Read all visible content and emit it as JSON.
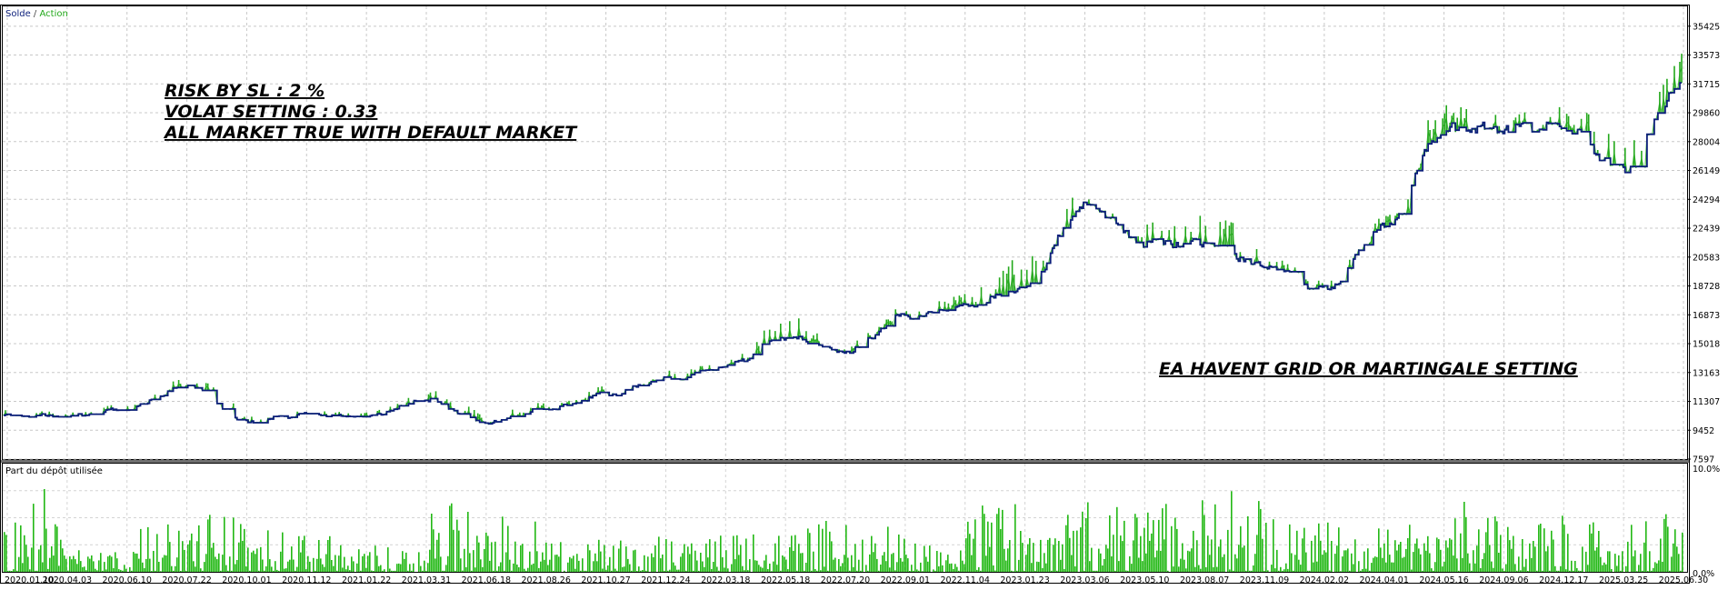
{
  "legend": {
    "balance_label": "Solde",
    "separator": " / ",
    "equity_label": "Action",
    "balance_color": "#0b1e7a",
    "equity_color": "#22a81a"
  },
  "annotations": {
    "line1": "RISK BY SL : 2 %",
    "line2": "VOLAT SETTING : 0.33",
    "line3": "ALL MARKET TRUE WITH DEFAULT MARKET",
    "note": "EA HAVENT GRID OR MARTINGALE SETTING"
  },
  "subpanel": {
    "title": "Part du dépôt utilisée",
    "y_max_label": "10.0%",
    "y_min_label": "0.0%"
  },
  "chart_data": [
    {
      "type": "line",
      "title": "",
      "series_names": [
        "Solde",
        "Action"
      ],
      "ylim": [
        7597,
        36700
      ],
      "y_ticks": [
        "35425",
        "33573",
        "31715",
        "29860",
        "28004",
        "26149",
        "24294",
        "22439",
        "20583",
        "18728",
        "16873",
        "15018",
        "13163",
        "11307",
        "9452",
        "7597"
      ],
      "x_ticks": [
        "2020.01.10",
        "2020.04.03",
        "2020.06.10",
        "2020.07.22",
        "2020.10.01",
        "2020.11.12",
        "2021.01.22",
        "2021.03.31",
        "2021.06.18",
        "2021.08.26",
        "2021.10.27",
        "2021.12.24",
        "2022.03.18",
        "2022.05.18",
        "2022.07.20",
        "2022.09.01",
        "2022.11.04",
        "2023.01.23",
        "2023.03.06",
        "2023.05.10",
        "2023.08.07",
        "2023.11.09",
        "2024.02.02",
        "2024.04.01",
        "2024.05.16",
        "2024.09.06",
        "2024.12.17",
        "2025.03.25",
        "2025.06.30"
      ],
      "x": [
        "2020.01.10",
        "2020.04.03",
        "2020.06.10",
        "2020.07.22",
        "2020.10.01",
        "2020.11.12",
        "2021.01.22",
        "2021.03.31",
        "2021.06.18",
        "2021.08.26",
        "2021.10.27",
        "2021.12.24",
        "2022.03.18",
        "2022.05.18",
        "2022.07.20",
        "2022.09.01",
        "2022.11.04",
        "2023.01.23",
        "2023.03.06",
        "2023.05.10",
        "2023.08.07",
        "2023.11.09",
        "2024.02.02",
        "2024.04.01",
        "2024.05.16",
        "2024.09.06",
        "2024.12.17",
        "2025.03.25",
        "2025.06.30"
      ],
      "series": [
        {
          "name": "Solde",
          "values": [
            10400,
            10350,
            10800,
            12300,
            10000,
            10450,
            10350,
            11400,
            9950,
            10800,
            11750,
            12700,
            13600,
            15400,
            14500,
            16800,
            17400,
            18600,
            24000,
            21500,
            21500,
            20000,
            18500,
            22500,
            28800,
            28900,
            28900,
            26200,
            31900
          ]
        },
        {
          "name": "Action",
          "values": [
            10600,
            10500,
            11000,
            12700,
            10200,
            10650,
            10550,
            11700,
            10300,
            11050,
            12000,
            13000,
            13800,
            16200,
            14800,
            17100,
            18000,
            20000,
            24700,
            22300,
            22900,
            20500,
            18900,
            23000,
            29900,
            29400,
            29700,
            27300,
            33300
          ]
        }
      ],
      "grid": true,
      "legend_position": "top-left"
    },
    {
      "type": "bar",
      "title": "Part du dépôt utilisée",
      "ylim": [
        0,
        10
      ],
      "y_ticks": [
        "10.0%",
        "0.0%"
      ],
      "description_values": "per-trade deposit usage, mostly 1-5%, peaks near 8%",
      "x": [
        "2020.01.10",
        "2020.04.03",
        "2020.06.10",
        "2020.07.22",
        "2020.10.01",
        "2020.11.12",
        "2021.01.22",
        "2021.03.31",
        "2021.06.18",
        "2021.08.26",
        "2021.10.27",
        "2021.12.24",
        "2022.03.18",
        "2022.05.18",
        "2022.07.20",
        "2022.09.01",
        "2022.11.04",
        "2023.01.23",
        "2023.03.06",
        "2023.05.10",
        "2023.08.07",
        "2023.11.09",
        "2024.02.02",
        "2024.04.01",
        "2024.05.16",
        "2024.09.06",
        "2024.12.17",
        "2025.03.25",
        "2025.06.30"
      ],
      "values": [
        7.8,
        3.2,
        4.8,
        6.4,
        4.5,
        3.5,
        2.8,
        8.1,
        5.3,
        3.0,
        3.8,
        4.5,
        3.5,
        5.1,
        4.7,
        3.3,
        7.2,
        5.9,
        7.3,
        6.7,
        7.5,
        5.3,
        5.6,
        5.0,
        6.5,
        5.7,
        4.9,
        5.6,
        6.1
      ]
    }
  ]
}
